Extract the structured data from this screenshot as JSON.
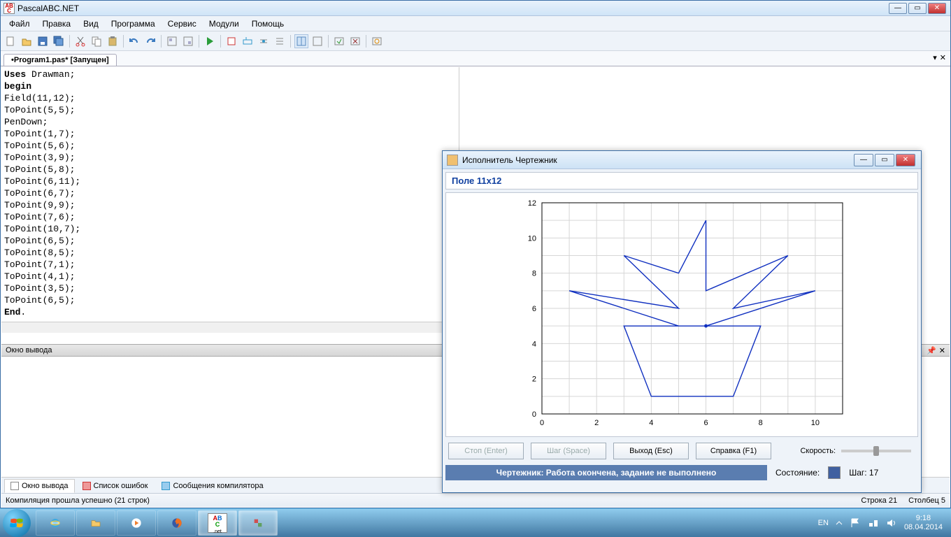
{
  "app": {
    "title": "PascalABC.NET"
  },
  "menu": [
    "Файл",
    "Правка",
    "Вид",
    "Программа",
    "Сервис",
    "Модули",
    "Помощь"
  ],
  "tab": {
    "label": "•Program1.pas* [Запущен]"
  },
  "code_lines": [
    "Uses Drawman;",
    "begin",
    "Field(11,12);",
    "ToPoint(5,5);",
    "PenDown;",
    "ToPoint(1,7);",
    "ToPoint(5,6);",
    "ToPoint(3,9);",
    "ToPoint(5,8);",
    "ToPoint(6,11);",
    "ToPoint(6,7);",
    "ToPoint(9,9);",
    "ToPoint(7,6);",
    "ToPoint(10,7);",
    "ToPoint(6,5);",
    "ToPoint(8,5);",
    "ToPoint(7,1);",
    "ToPoint(4,1);",
    "ToPoint(3,5);",
    "ToPoint(6,5);",
    "End."
  ],
  "output_header": "Окно вывода",
  "bottom_tabs": {
    "a": "Окно вывода",
    "b": "Список ошибок",
    "c": "Сообщения компилятора"
  },
  "status": {
    "msg": "Компиляция прошла успешно (21 строк)",
    "line": "Строка  21",
    "col": "Столбец  5"
  },
  "child": {
    "title": "Исполнитель Чертежник",
    "field_label": "Поле 11x12",
    "buttons": {
      "stop": "Стоп (Enter)",
      "step": "Шаг (Space)",
      "exit": "Выход (Esc)",
      "help": "Справка (F1)"
    },
    "speed_label": "Скорость:",
    "state_label": "Состояние:",
    "step_text": "Шаг: 17",
    "status_msg": "Чертежник: Работа окончена, задание не выполнено"
  },
  "taskbar": {
    "lang": "EN",
    "time": "9:18",
    "date": "08.04.2014"
  },
  "chart_data": {
    "type": "line",
    "title": "",
    "xlabel": "",
    "ylabel": "",
    "xlim": [
      0,
      11
    ],
    "ylim": [
      0,
      12
    ],
    "xticks": [
      0,
      2,
      4,
      6,
      8,
      10
    ],
    "yticks": [
      0,
      2,
      4,
      6,
      8,
      10,
      12
    ],
    "series": [
      {
        "name": "drawing",
        "points": [
          [
            5,
            5
          ],
          [
            1,
            7
          ],
          [
            5,
            6
          ],
          [
            3,
            9
          ],
          [
            5,
            8
          ],
          [
            6,
            11
          ],
          [
            6,
            7
          ],
          [
            9,
            9
          ],
          [
            7,
            6
          ],
          [
            10,
            7
          ],
          [
            6,
            5
          ],
          [
            8,
            5
          ],
          [
            7,
            1
          ],
          [
            4,
            1
          ],
          [
            3,
            5
          ],
          [
            6,
            5
          ]
        ]
      }
    ]
  }
}
